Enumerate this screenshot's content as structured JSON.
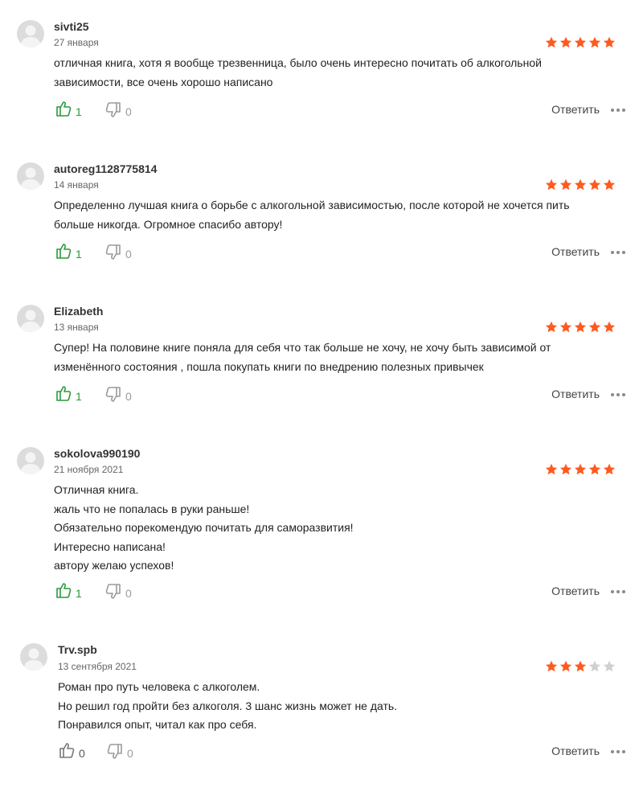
{
  "colors": {
    "star_on": "#ff5a1f",
    "star_off": "#d0d0d0",
    "like_active": "#2a9a3b",
    "like_inactive": "#777777",
    "dislike": "#9a9a9a"
  },
  "icons": {
    "avatar": "user-silhouette",
    "like": "thumbs-up",
    "dislike": "thumbs-down",
    "more": "ellipsis"
  },
  "reviews": [
    {
      "author": "sivti25",
      "date": "27 января",
      "rating": 5,
      "text": "отличная книга, хотя я вообще трезвенница, было очень интересно почитать об алкогольной\nзависимости, все очень хорошо написано",
      "likes": "1",
      "dislikes": "0",
      "reply_label": "Ответить"
    },
    {
      "author": "autoreg1128775814",
      "date": "14 января",
      "rating": 5,
      "text": "Определенно лучшая книга о борьбе с алкогольной зависимостью, после которой не хочется пить\nбольше никогда. Огромное спасибо автору!",
      "likes": "1",
      "dislikes": "0",
      "reply_label": "Ответить"
    },
    {
      "author": "Elizabeth",
      "date": "13 января",
      "rating": 5,
      "text": "Супер! На половине книге поняла для себя что так больше не хочу, не хочу быть зависимой от\nизменённого состояния , пошла покупать книги по внедрению полезных привычек",
      "likes": "1",
      "dislikes": "0",
      "reply_label": "Ответить"
    },
    {
      "author": "sokolova990190",
      "date": "21 ноября 2021",
      "rating": 5,
      "text": "Отличная книга.\nжаль что не попалась в руки раньше!\nОбязательно порекомендую почитать для саморазвития!\nИнтересно написана!\nавтору желаю успехов!",
      "likes": "1",
      "dislikes": "0",
      "reply_label": "Ответить"
    },
    {
      "author": "Trv.spb",
      "date": "13 сентября 2021",
      "rating": 3,
      "text": "Роман про путь человека с алкоголем.\nНо решил год пройти без алкоголя. 3 шанс жизнь может не дать.\nПонравился опыт, читал как про себя.",
      "likes": "0",
      "dislikes": "0",
      "reply_label": "Ответить"
    }
  ]
}
